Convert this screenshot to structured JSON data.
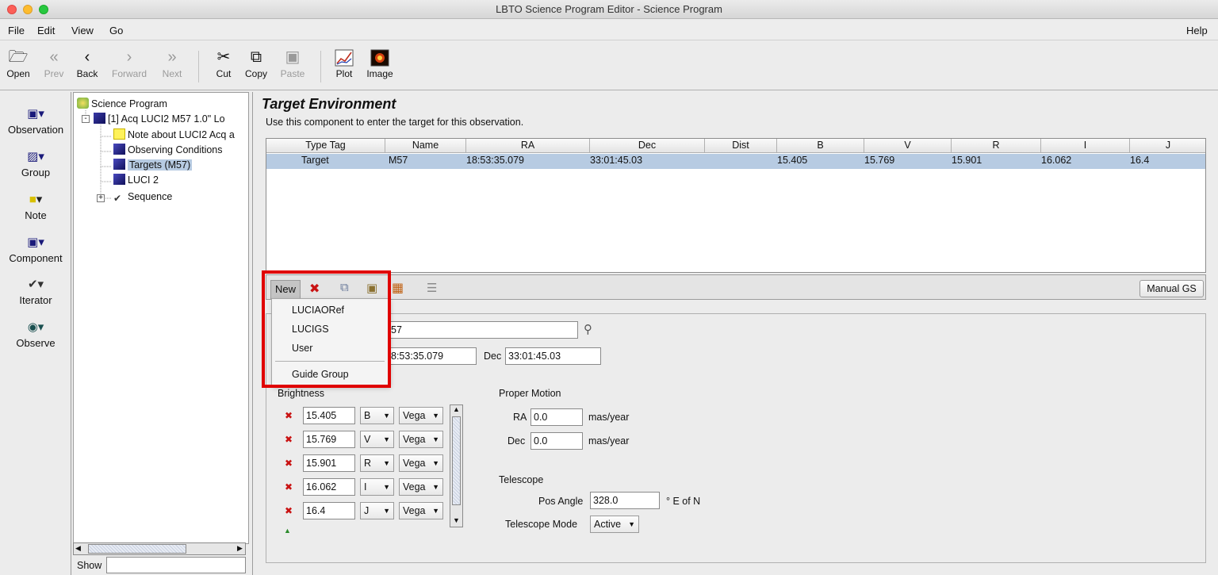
{
  "window": {
    "title": "LBTO Science Program Editor - Science Program"
  },
  "menubar": {
    "items": [
      "File",
      "Edit",
      "View",
      "Go"
    ],
    "help": "Help"
  },
  "toolbar": {
    "open": "Open",
    "prev": "Prev",
    "back": "Back",
    "forward": "Forward",
    "next": "Next",
    "cut": "Cut",
    "copy": "Copy",
    "paste": "Paste",
    "plot": "Plot",
    "image": "Image"
  },
  "palette": {
    "items": [
      "Observation",
      "Group",
      "Note",
      "Component",
      "Iterator",
      "Observe"
    ]
  },
  "tree": {
    "root": "Science Program",
    "obs": "[1] Acq LUCI2 M57 1.0\" Lo",
    "note": "Note about LUCI2 Acq a",
    "conditions": "Observing Conditions",
    "targets": "Targets (M57)",
    "luci": "LUCI 2",
    "sequence": "Sequence",
    "show_label": "Show"
  },
  "editor": {
    "title": "Target Environment",
    "description": "Use this component to enter the target for this observation.",
    "table": {
      "headers": [
        "Type Tag",
        "Name",
        "RA",
        "Dec",
        "Dist",
        "B",
        "V",
        "R",
        "I",
        "J"
      ],
      "row": [
        "Target",
        "M57",
        "18:53:35.079",
        "33:01:45.03",
        "",
        "15.405",
        "15.769",
        "15.901",
        "16.062",
        "16.4"
      ]
    },
    "new_label": "New",
    "manual_gs": "Manual GS",
    "name_value": "57",
    "ra_value": "8:53:35.079",
    "dec_label": "Dec",
    "dec_value": "33:01:45.03",
    "brightness_label": "Brightness",
    "brightness": [
      {
        "value": "15.405",
        "band": "B",
        "system": "Vega"
      },
      {
        "value": "15.769",
        "band": "V",
        "system": "Vega"
      },
      {
        "value": "15.901",
        "band": "R",
        "system": "Vega"
      },
      {
        "value": "16.062",
        "band": "I",
        "system": "Vega"
      },
      {
        "value": "16.4",
        "band": "J",
        "system": "Vega"
      }
    ],
    "proper_motion": {
      "label": "Proper Motion",
      "ra_label": "RA",
      "ra_value": "0.0",
      "dec_label": "Dec",
      "dec_value": "0.0",
      "unit": "mas/year"
    },
    "telescope": {
      "label": "Telescope",
      "pos_angle_label": "Pos Angle",
      "pos_angle_value": "328.0",
      "pos_angle_unit": "° E of N",
      "mode_label": "Telescope Mode",
      "mode_value": "Active"
    }
  },
  "popup": {
    "items": [
      "LUCIAORef",
      "LUCIGS",
      "User",
      "Guide Group"
    ]
  },
  "colors": {
    "highlight": "#e00000",
    "selection": "#b7cbe2"
  }
}
